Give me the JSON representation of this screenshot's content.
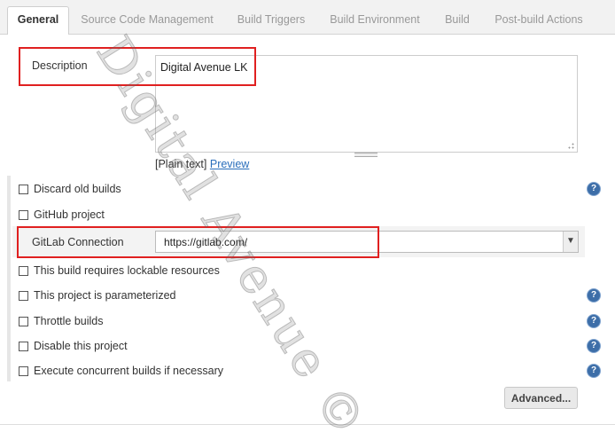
{
  "tabs": [
    {
      "label": "General",
      "active": true
    },
    {
      "label": "Source Code Management",
      "active": false
    },
    {
      "label": "Build Triggers",
      "active": false
    },
    {
      "label": "Build Environment",
      "active": false
    },
    {
      "label": "Build",
      "active": false
    },
    {
      "label": "Post-build Actions",
      "active": false
    }
  ],
  "description": {
    "label": "Description",
    "value": "Digital Avenue LK",
    "format_plain": "[Plain text]",
    "preview_link": "Preview"
  },
  "options": {
    "discard_old_builds": "Discard old builds",
    "github_project": "GitHub project",
    "gitlab_label": "GitLab Connection",
    "gitlab_value": "https://gitlab.com/",
    "lockable_resources": "This build requires lockable resources",
    "parameterized": "This project is parameterized",
    "throttle": "Throttle builds",
    "disable": "Disable this project",
    "concurrent": "Execute concurrent builds if necessary"
  },
  "advanced_button": "Advanced...",
  "help_icon": "?",
  "watermark": "Digital Avenue ©",
  "colors": {
    "highlight": "#e02020",
    "link": "#2a6ebb",
    "help": "#3d6ea8"
  }
}
